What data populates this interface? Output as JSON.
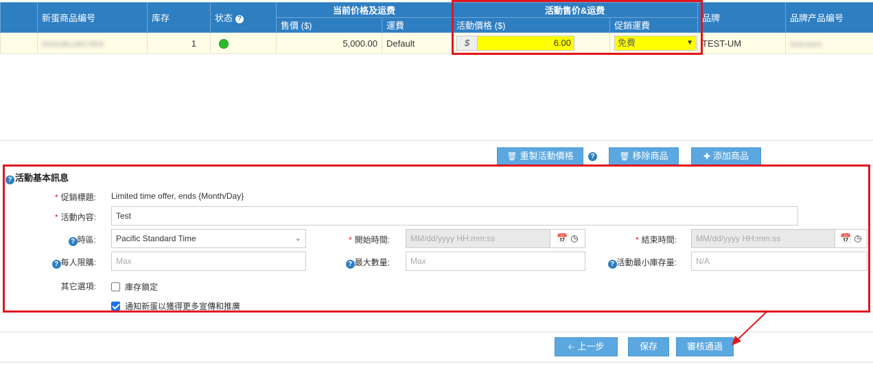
{
  "table": {
    "group_current": "当前价格及运费",
    "group_promo": "活動售价&运费",
    "headers": {
      "product_no": "新蛋商品编号",
      "stock": "库存",
      "status": "状态",
      "price": "售價 ($)",
      "shipping": "運費",
      "promo_price": "活動價格 ($)",
      "promo_shipping": "促銷運費",
      "brand": "品牌",
      "brand_product_no": "品牌产品编号"
    },
    "row": {
      "product_no": "9SIA2BUJ8G7654",
      "stock": "1",
      "status_color": "#2dbb2d",
      "price": "5,000.00",
      "shipping": "Default",
      "currency": "$",
      "promo_price": "6.00",
      "promo_shipping": "免費",
      "brand": "TEST-UM",
      "brand_product_no": "testcase1"
    }
  },
  "toolbar": {
    "reset_price": "重製活動價格",
    "remove_item": "移除商品",
    "add_item": "添加商品"
  },
  "form": {
    "title": "活動基本訊息",
    "promo_title_label": "促銷標題:",
    "promo_title_value": "Limited time offer, ends {Month/Day}",
    "content_label": "活動內容:",
    "content_value": "Test",
    "timezone_label": "時區:",
    "timezone_value": "Pacific Standard Time",
    "start_label": "開始時間:",
    "start_placeholder": "MM/dd/yyyy HH:mm:ss",
    "end_label": "結束時間:",
    "end_placeholder": "MM/dd/yyyy HH:mm:ss",
    "limit_label": "每人限購:",
    "limit_placeholder": "Max",
    "max_qty_label": "最大數量:",
    "max_qty_placeholder": "Max",
    "min_stock_label": "活動最小庫存量:",
    "min_stock_placeholder": "N/A",
    "other_label": "其它選項:",
    "opt_lock_stock": "庫存鎖定",
    "opt_lock_stock_checked": false,
    "opt_notify": "通知新蛋以獲得更多宣傳和推廣",
    "opt_notify_checked": true
  },
  "footer": {
    "back": "上一步",
    "save": "保存",
    "submit": "審核通過"
  },
  "colors": {
    "header_blue": "#2e7ec2",
    "button_blue": "#5ba7e0",
    "highlight_yellow": "#ffff00",
    "annotation_red": "#e0141e"
  }
}
